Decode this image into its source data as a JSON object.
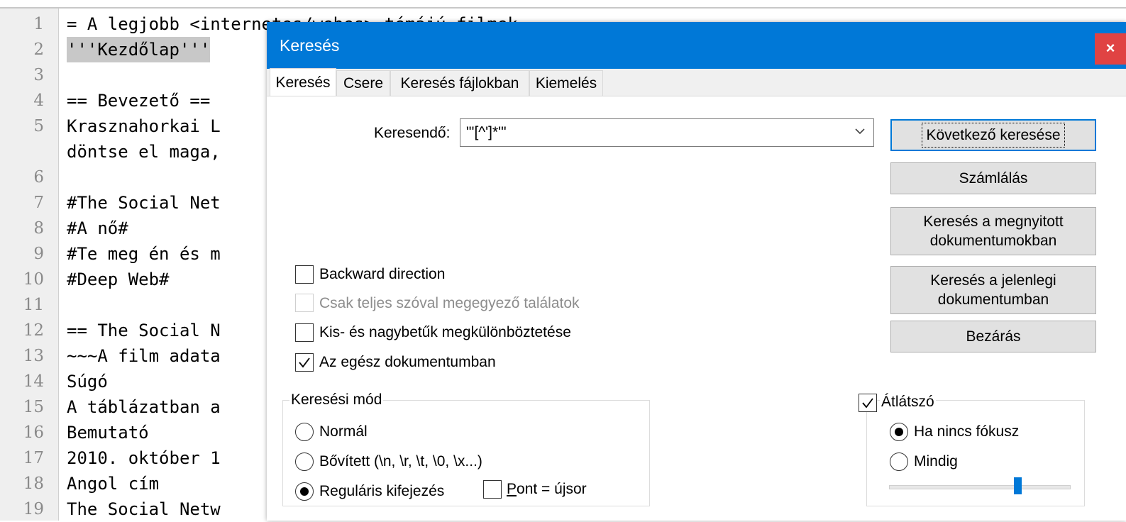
{
  "editor": {
    "line_numbers": [
      "1",
      "2",
      "3",
      "4",
      "5",
      "",
      "6",
      "7",
      "8",
      "9",
      "10",
      "11",
      "12",
      "13",
      "14",
      "15",
      "16",
      "17",
      "18",
      "19"
    ],
    "lines": [
      "= A legjobb <internetes/webes> témájú filmek =",
      "'''Kezdőlap'''",
      "",
      "== Bevezető ==",
      "Krasznahorkai L",
      "döntse el maga,",
      "",
      "#The Social Net",
      "#A nő#",
      "#Te meg én és m",
      "#Deep Web#",
      "",
      "== The Social N",
      "~~~A film adata",
      "Súgó",
      "A táblázatban a",
      "Bemutató",
      "2010. október 1",
      "Angol cím",
      "The Social Netw"
    ]
  },
  "dialog": {
    "title": "Keresés",
    "close_glyph": "×",
    "tabs": [
      "Keresés",
      "Csere",
      "Keresés fájlokban",
      "Kiemelés"
    ],
    "active_tab": "Keresés",
    "find_label": "Keresendő:",
    "find_value": "\"'[^']*'\"",
    "buttons": {
      "find_next": "Következő keresése",
      "count": "Számlálás",
      "find_all_open_1": "Keresés a megnyitott",
      "find_all_open_2": "dokumentumokban",
      "find_all_current_1": "Keresés a jelenlegi",
      "find_all_current_2": "dokumentumban",
      "close": "Bezárás"
    },
    "options": {
      "backward": {
        "label": "Backward direction",
        "checked": false
      },
      "whole_word": {
        "label": "Csak teljes szóval megegyező találatok",
        "checked": false,
        "disabled": true
      },
      "match_case": {
        "label": "Kis- és nagybetűk megkülönböztetése",
        "checked": false
      },
      "wrap": {
        "label": "Az egész dokumentumban",
        "checked": true
      }
    },
    "search_mode": {
      "group_label": "Keresési mód",
      "normal": "Normál",
      "extended": "Bővített (\\n, \\r, \\t, \\0, \\x...)",
      "regex": "Reguláris kifejezés",
      "selected": "regex",
      "dot_newline_p": "P",
      "dot_newline_rest": "ont = újsor",
      "dot_newline_checked": false
    },
    "transparency": {
      "label": "Átlátszó",
      "checked": true,
      "on_losing_focus": "Ha nincs fókusz",
      "always": "Mindig",
      "selected": "on_losing_focus",
      "slider_level": 0.7
    }
  }
}
